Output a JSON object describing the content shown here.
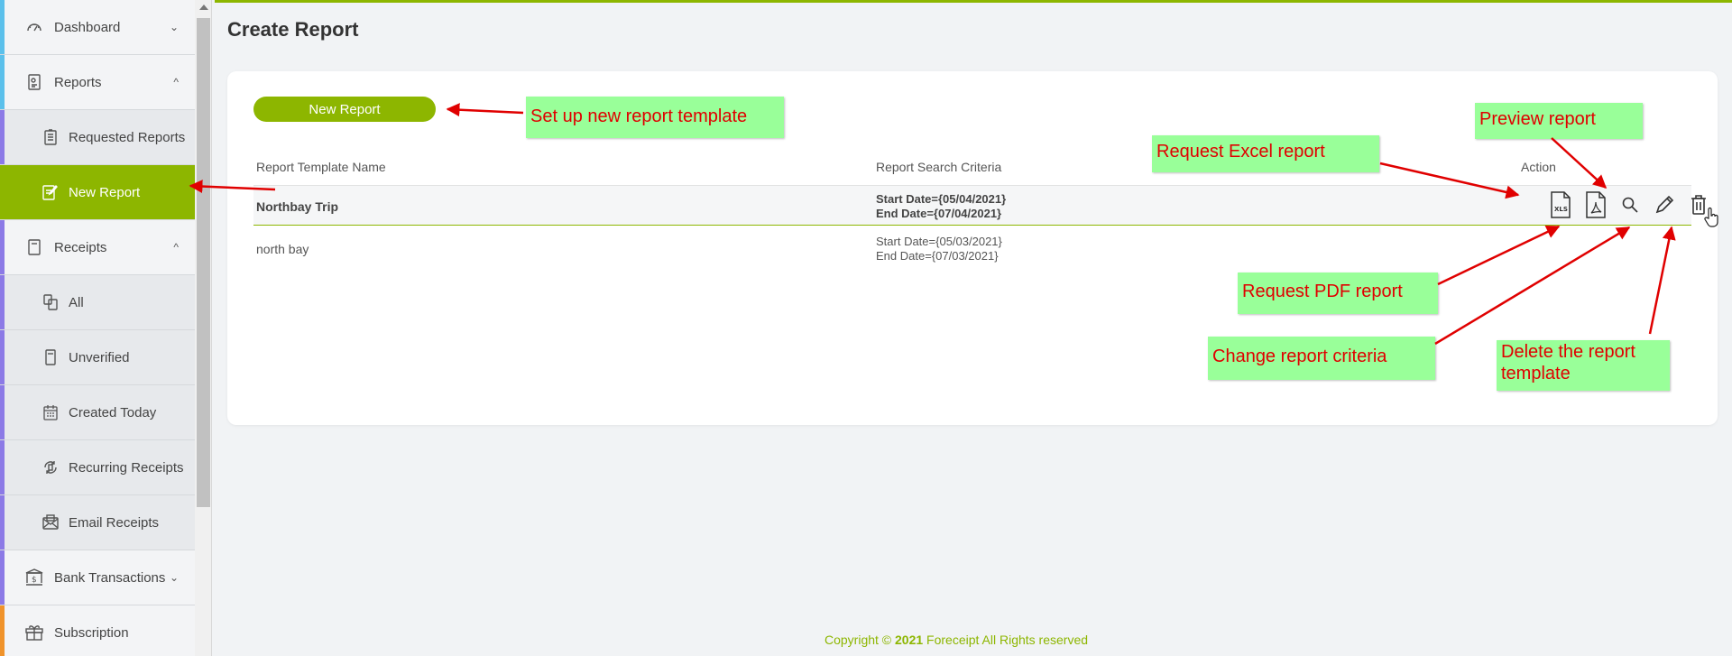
{
  "page": {
    "title": "Create Report"
  },
  "sidebar": {
    "items": [
      {
        "label": "Dashboard",
        "icon": "gauge-icon",
        "chevron": "⌄",
        "bar": "#5bc0eb"
      },
      {
        "label": "Reports",
        "icon": "report-icon",
        "chevron": "^",
        "bar": "#5bc0eb"
      },
      {
        "label": "Requested Reports",
        "icon": "document-list-icon",
        "bar": "#8c7ae6"
      },
      {
        "label": "New Report",
        "icon": "edit-document-icon",
        "bar": "#8db600"
      },
      {
        "label": "Receipts",
        "icon": "receipt-icon",
        "chevron": "^",
        "bar": "#8c7ae6"
      },
      {
        "label": "All",
        "icon": "copy-icon",
        "bar": "#8c7ae6"
      },
      {
        "label": "Unverified",
        "icon": "receipt-icon",
        "bar": "#8c7ae6"
      },
      {
        "label": "Created Today",
        "icon": "calendar-icon",
        "bar": "#8c7ae6"
      },
      {
        "label": "Recurring Receipts",
        "icon": "recurring-icon",
        "bar": "#8c7ae6"
      },
      {
        "label": "Email Receipts",
        "icon": "mail-icon",
        "bar": "#8c7ae6"
      },
      {
        "label": "Bank Transactions",
        "icon": "bank-icon",
        "chevron": "⌄",
        "bar": "#8c7ae6"
      },
      {
        "label": "Subscription",
        "icon": "gift-icon",
        "bar": "#f0932b"
      }
    ]
  },
  "toolbar": {
    "new_report_label": "New Report"
  },
  "table": {
    "headers": {
      "name": "Report Template Name",
      "criteria": "Report Search Criteria",
      "action": "Action"
    },
    "rows": [
      {
        "name": "Northbay Trip",
        "criteria_start": "Start Date={05/04/2021}",
        "criteria_end": "End Date={07/04/2021}"
      },
      {
        "name": "north bay",
        "criteria_start": "Start Date={05/03/2021}",
        "criteria_end": "End Date={07/03/2021}"
      }
    ],
    "actions": {
      "xls_icon_text": "XLS"
    }
  },
  "annotations": {
    "new_template": "Set up new report template",
    "excel": "Request Excel report",
    "preview": "Preview report",
    "pdf": "Request PDF report",
    "criteria": "Change report criteria",
    "delete": "Delete the report template"
  },
  "footer": {
    "prefix": "Copyright © ",
    "year": "2021",
    "suffix": " Foreceipt All Rights reserved"
  },
  "colors": {
    "accent": "#8db600",
    "annotation_bg": "#99ff99",
    "annotation_text": "#e00000"
  }
}
